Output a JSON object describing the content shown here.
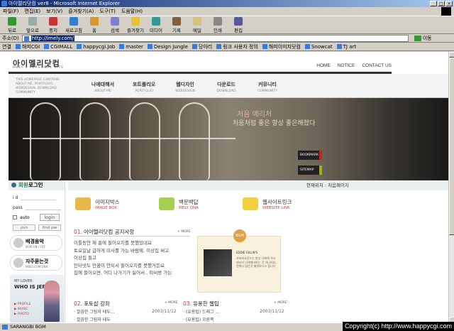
{
  "window": {
    "title": "아이멜리닷컴 ver8 - Microsoft Internet Explorer",
    "controls": [
      "_",
      "□",
      "×"
    ]
  },
  "menu": [
    "파일(F)",
    "편집(E)",
    "보기(V)",
    "즐겨찾기(A)",
    "도구(T)",
    "도움말(H)"
  ],
  "toolbar": [
    {
      "label": "뒤로",
      "color": "#2f9a2f"
    },
    {
      "label": "앞으로",
      "color": "#9aa"
    },
    {
      "label": "중지",
      "color": "#c33"
    },
    {
      "label": "새로고침",
      "color": "#2f7fd5"
    },
    {
      "label": "홈",
      "color": "#d59a2f"
    },
    {
      "label": "검색",
      "color": "#7f7fd5"
    },
    {
      "label": "즐겨찾기",
      "color": "#e8c22f"
    },
    {
      "label": "미디어",
      "color": "#2f9a9a"
    },
    {
      "label": "기록",
      "color": "#7f5f3f"
    },
    {
      "label": "메일",
      "color": "#d5c27f"
    },
    {
      "label": "인쇄",
      "color": "#888"
    },
    {
      "label": "편집",
      "color": "#5a5a9a"
    }
  ],
  "address": {
    "label": "주소(D)",
    "value": "http://imely.com/",
    "go": "이동"
  },
  "links": {
    "label": "연결",
    "items": [
      "해피CGI",
      "CGIMALL",
      "happycgi.Job",
      "master",
      "Design Jungle",
      "당아리",
      "링크 사용자 정의",
      "해피이미지닷컴",
      "Snowcat",
      "TJ art"
    ]
  },
  "site": {
    "logo": "아이멜리닷컴",
    "logo_sub": "MELY'S PERSONAL SITE",
    "topnav": [
      "HOME",
      "NOTICE",
      "CONTACT US"
    ],
    "tagline": "THIS HOMEPAGE CONTAINS ABOUT ME, PORTFOLIO, WEBDESIGN, DOWNLOAD COMMUNITY",
    "nav": [
      {
        "ko": "나에대해서",
        "en": "ABOUT ME"
      },
      {
        "ko": "포트폴리오",
        "en": "PORTFOLIO"
      },
      {
        "ko": "웹디자인",
        "en": "WEBDESIGN"
      },
      {
        "ko": "다운로드",
        "en": "DOWNLOAD"
      },
      {
        "ko": "커뮤니티",
        "en": "COMMUNITY"
      }
    ],
    "hero": {
      "text1": "처음 예리처",
      "text2": "처음처럼 좋은 항상 좋은해졌다",
      "bookmark": "BOOKMARK",
      "sitemap": "SITEMAP"
    },
    "login": {
      "title_a": "회원",
      "title_b": "로그인",
      "id_label": "i d",
      "pw_label": "pass",
      "auto_label": "auto",
      "login_btn": "login",
      "join": "join",
      "find": "find pw"
    },
    "promos": [
      {
        "title": "배경음악",
        "sub": "BGM ON / OFF"
      },
      {
        "title": "자주묻는것",
        "sub": "IMELY.COM QNA"
      }
    ],
    "jerry": {
      "small": "MY LOVER",
      "big": "WHO IS JERRY?",
      "items": [
        "PROFILE",
        "MUSIC",
        "PHOTO"
      ]
    },
    "crumb": "현재위치 : 처음페이지",
    "quicklinks": [
      {
        "title": "이미지박스",
        "sub": "IMAGE BOX",
        "color": "#e8b84a"
      },
      {
        "title": "백문백답",
        "sub": "MELY QNA",
        "color": "#a8d050"
      },
      {
        "title": "웹사이트링크",
        "sub": "WEBSITE LINK",
        "color": "#f0d040"
      }
    ],
    "notice": {
      "num": "01.",
      "title": "아이멜리닷컴 공지사항",
      "more": "MORE",
      "lines": [
        "이틀동안 제 홈에 들어오지를 못했었네요",
        "토요일날 급하게 미사를 가는 바람에. 이상집 써고",
        "이상집 들고",
        "인터넷도 안꿈이 안되서 들어오지를 못했거든요",
        "집에 들어오면. 어디 나가기가 싫어서.. 피씨방 가는"
      ]
    },
    "bgm": {
      "badge": "BGM",
      "name": "EDDIE GILLIN'S",
      "desc": "카바레사운드는 항상 나에게 가서 데리러 이해해야하는 것 아니어요. 전에서 많은것 배워보다고 합니다"
    },
    "photo": {
      "num": "02.",
      "title": "포토샵 강좌",
      "more": "MORE",
      "items": [
        {
          "title": "· 깔끔한 그림자 테두...",
          "date": "2003/11/12"
        },
        {
          "title": "· 깔끔한 그림자 테두",
          "date": "2003/11/12"
        }
      ]
    },
    "tips": {
      "num": "03.",
      "title": "유용한 웹팁",
      "more": "MORE",
      "items": [
        {
          "title": "· (유용팁) 드래그 ...",
          "date": "2003/11/12"
        },
        {
          "title": "· (유용팁) 오른쪽",
          "date": "2003/11/12"
        }
      ]
    }
  },
  "status": "SARANGBI BGM",
  "watermark": "Copyright(c) http://www.happycgi.com"
}
